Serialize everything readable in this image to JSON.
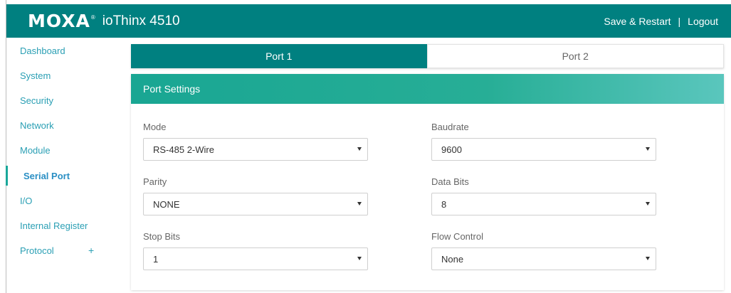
{
  "header": {
    "brand": "MOXA",
    "brand_mark": "®",
    "product": "ioThinx 4510",
    "save_restart": "Save & Restart",
    "separator": "|",
    "logout": "Logout"
  },
  "sidebar": {
    "items": [
      {
        "label": "Dashboard"
      },
      {
        "label": "System"
      },
      {
        "label": "Security"
      },
      {
        "label": "Network"
      },
      {
        "label": "Module"
      },
      {
        "label": "Serial Port",
        "active": true
      },
      {
        "label": "I/O"
      },
      {
        "label": "Internal Register"
      },
      {
        "label": "Protocol",
        "expand": "+"
      }
    ]
  },
  "tabs": [
    {
      "label": "Port 1",
      "active": true
    },
    {
      "label": "Port 2",
      "active": false
    }
  ],
  "panel": {
    "title": "Port Settings",
    "fields": {
      "mode": {
        "label": "Mode",
        "value": "RS-485 2-Wire"
      },
      "baudrate": {
        "label": "Baudrate",
        "value": "9600"
      },
      "parity": {
        "label": "Parity",
        "value": "NONE"
      },
      "data_bits": {
        "label": "Data Bits",
        "value": "8"
      },
      "stop_bits": {
        "label": "Stop Bits",
        "value": "1"
      },
      "flow_control": {
        "label": "Flow Control",
        "value": "None"
      }
    }
  },
  "colors": {
    "topbar": "#008080",
    "accent": "#1aa79a",
    "sidebar_link": "#2a9fb4"
  }
}
